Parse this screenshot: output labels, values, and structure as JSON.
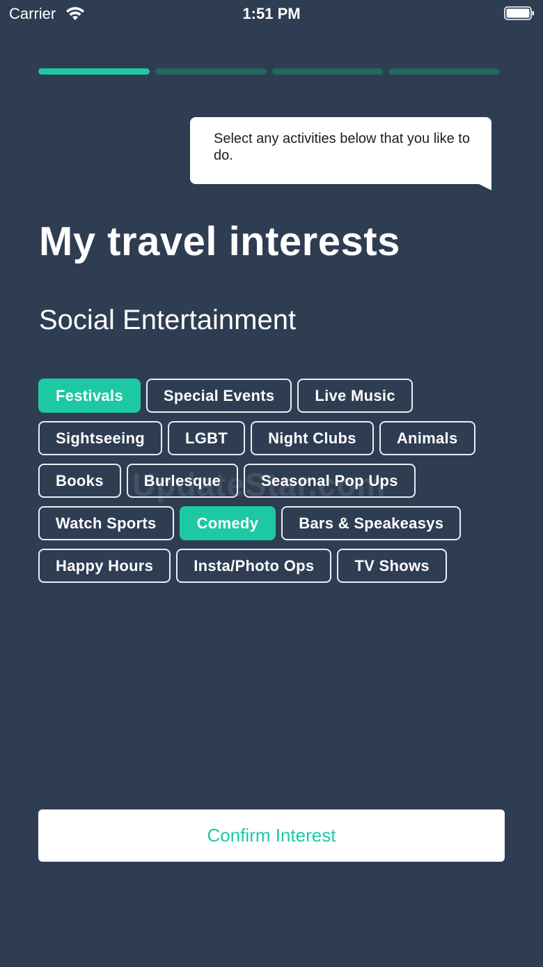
{
  "status_bar": {
    "carrier": "Carrier",
    "time": "1:51 PM",
    "wifi_icon": "wifi-icon",
    "battery_icon": "battery-icon"
  },
  "progress": {
    "segments": 4,
    "current_step": 1,
    "active_color": "#1cc9a2",
    "inactive_color": "#22685e"
  },
  "bubble": {
    "text": "Select any activities below that you like to do."
  },
  "page_title": "My travel interests",
  "section_title": "Social Entertainment",
  "chips": [
    {
      "label": "Festivals",
      "selected": true
    },
    {
      "label": "Special Events",
      "selected": false
    },
    {
      "label": "Live Music",
      "selected": false
    },
    {
      "label": "Sightseeing",
      "selected": false
    },
    {
      "label": "LGBT",
      "selected": false
    },
    {
      "label": "Night Clubs",
      "selected": false
    },
    {
      "label": "Animals",
      "selected": false
    },
    {
      "label": "Books",
      "selected": false
    },
    {
      "label": "Burlesque",
      "selected": false
    },
    {
      "label": "Seasonal Pop Ups",
      "selected": false
    },
    {
      "label": "Watch Sports",
      "selected": false
    },
    {
      "label": "Comedy",
      "selected": true
    },
    {
      "label": "Bars & Speakeasys",
      "selected": false
    },
    {
      "label": "Happy Hours",
      "selected": false
    },
    {
      "label": "Insta/Photo Ops",
      "selected": false
    },
    {
      "label": "TV Shows",
      "selected": false
    }
  ],
  "confirm_button": {
    "label": "Confirm Interest"
  },
  "watermark": "UpdateStar.com",
  "colors": {
    "background": "#2f3d53",
    "accent": "#1cc9a2"
  }
}
